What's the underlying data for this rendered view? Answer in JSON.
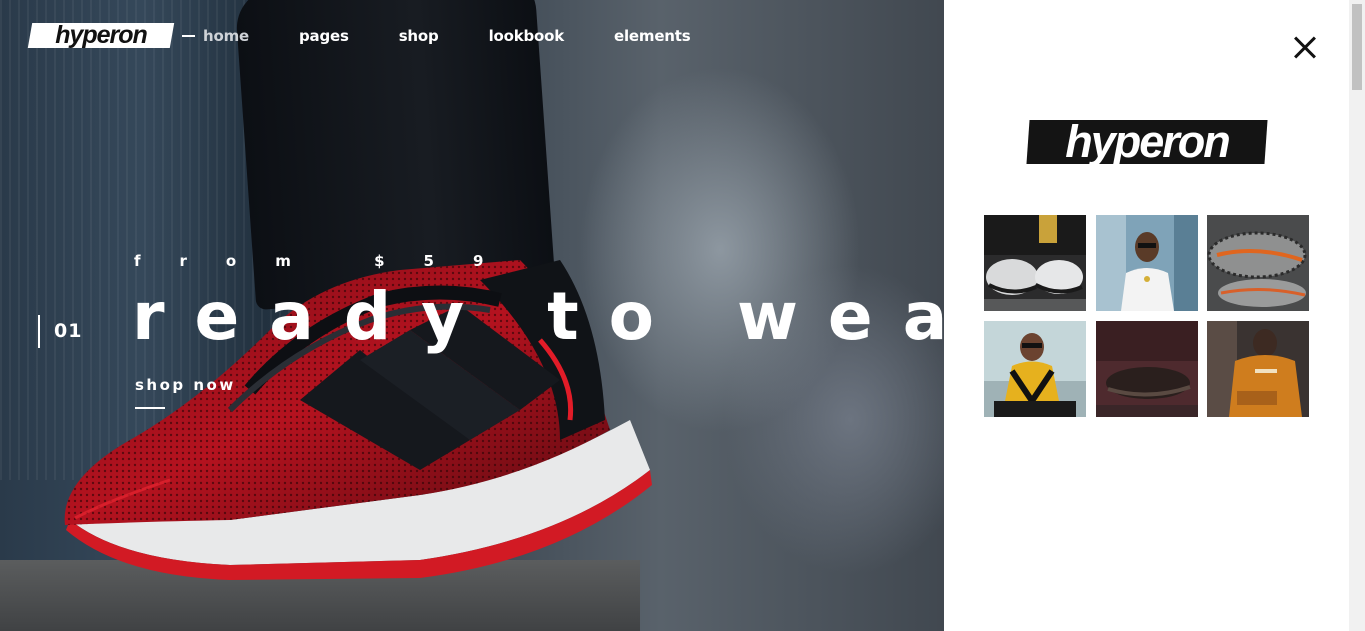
{
  "brand": {
    "logo_text": "hyperon"
  },
  "nav": {
    "items": [
      {
        "label": "home",
        "active": true
      },
      {
        "label": "pages",
        "active": false
      },
      {
        "label": "shop",
        "active": false
      },
      {
        "label": "lookbook",
        "active": false
      },
      {
        "label": "elements",
        "active": false
      }
    ]
  },
  "hero": {
    "slide_number": "01",
    "subtitle": "from $59",
    "title": "ready to wear",
    "cta_label": "shop now"
  },
  "side_panel": {
    "logo_text": "hyperon",
    "close_icon": "close-icon",
    "gallery_icons": [
      "sneakers-photo",
      "rapper-portrait-photo",
      "yeezy-sneakers-photo",
      "woman-yellow-jacket-photo",
      "dark-sneakers-photo",
      "orange-hoodie-photo"
    ]
  },
  "colors": {
    "panel_background": "#ffffff",
    "logo_background": "#141414",
    "text_on_hero": "#ffffff"
  }
}
